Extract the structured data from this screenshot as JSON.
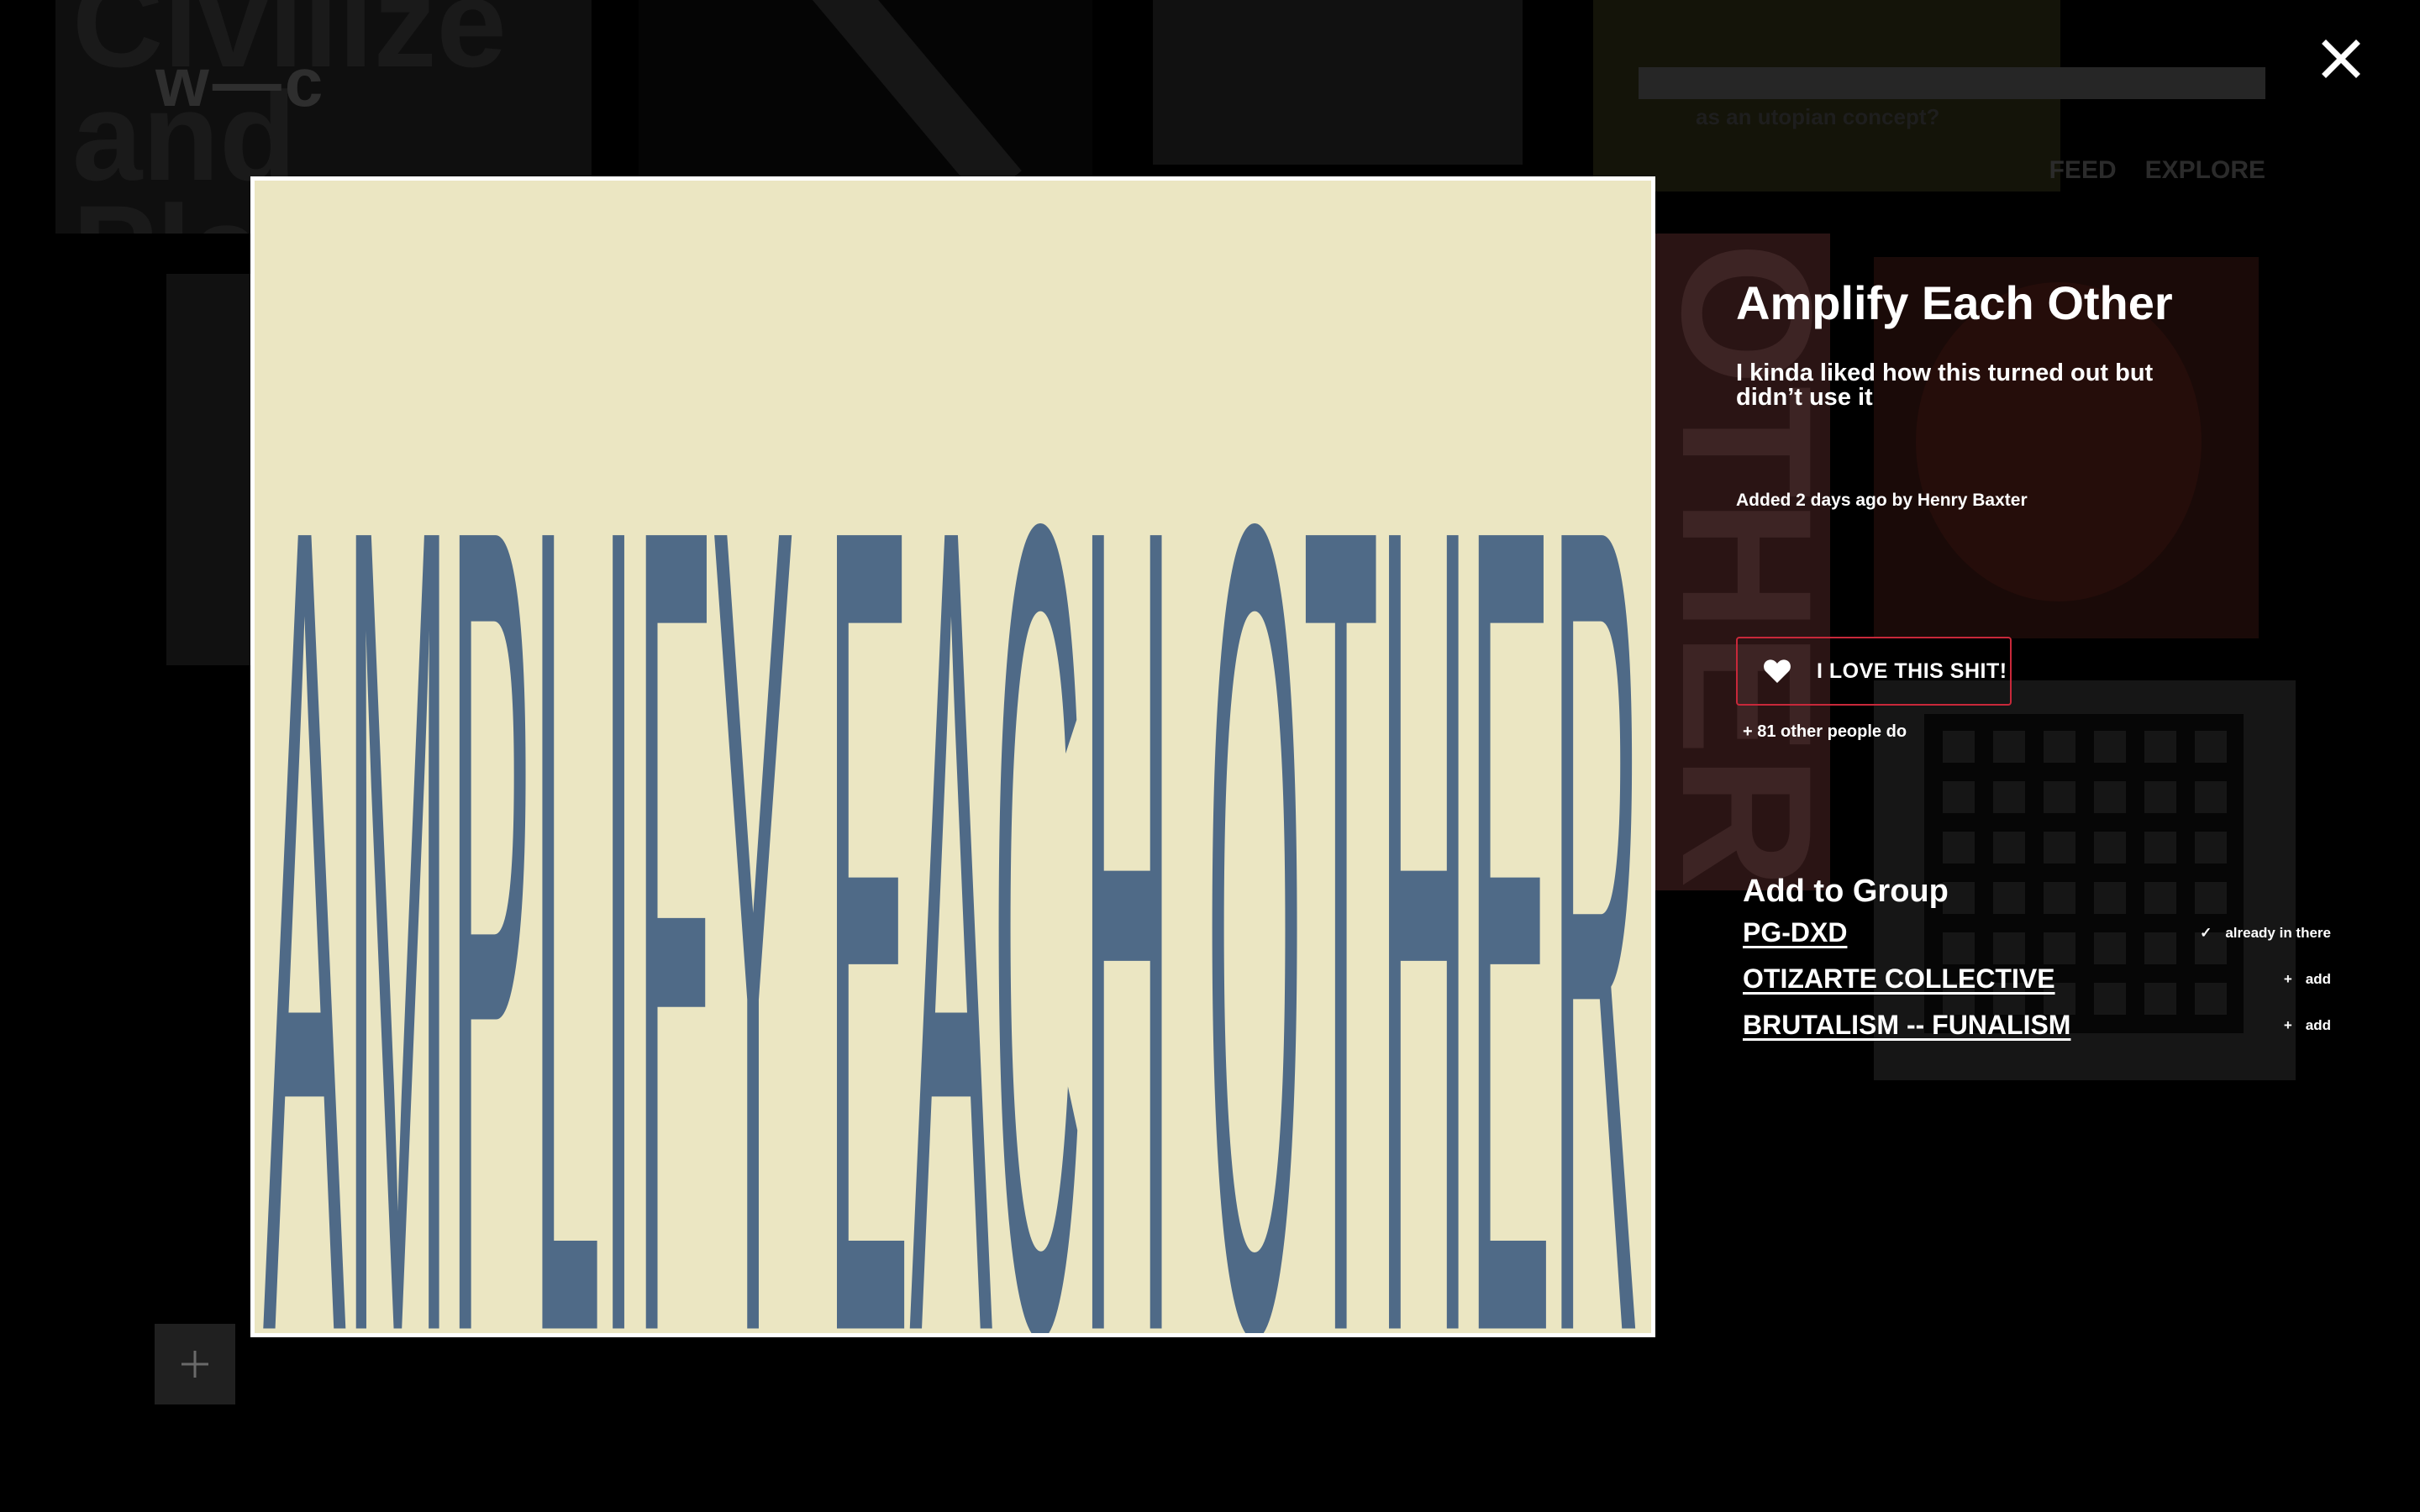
{
  "background": {
    "logo": "w—c",
    "ticker": "as an utopian concept?",
    "nav": [
      "FEED",
      "EXPLORE"
    ],
    "poster_1_text": "Civilize and Plan",
    "poster_2_text": "OTHER"
  },
  "modal": {
    "artwork_text": "AMPLIFY EACH OTHER",
    "colors": {
      "artwork_bg": "#ebe6c2",
      "artwork_ink": "#4f6a87",
      "love_border": "#c8283a"
    },
    "title": "Amplify Each Other",
    "description": "I kinda liked how this turned out but didn’t use it",
    "meta": "Added 2 days ago by Henry Baxter",
    "love_button": {
      "icon": "heart-icon",
      "label": "I LOVE THIS SHIT!"
    },
    "love_count": "+ 81 other people do",
    "groups": {
      "heading": "Add to Group",
      "items": [
        {
          "name": "PG-DXD",
          "action_icon": "check-icon",
          "action_glyph": "✓",
          "action_label": "already in there"
        },
        {
          "name": "OTIZARTE COLLECTIVE",
          "action_icon": "plus-icon",
          "action_glyph": "+",
          "action_label": "add"
        },
        {
          "name": "BRUTALISM -- FUNALISM",
          "action_icon": "plus-icon",
          "action_glyph": "+",
          "action_label": "add"
        }
      ]
    }
  }
}
